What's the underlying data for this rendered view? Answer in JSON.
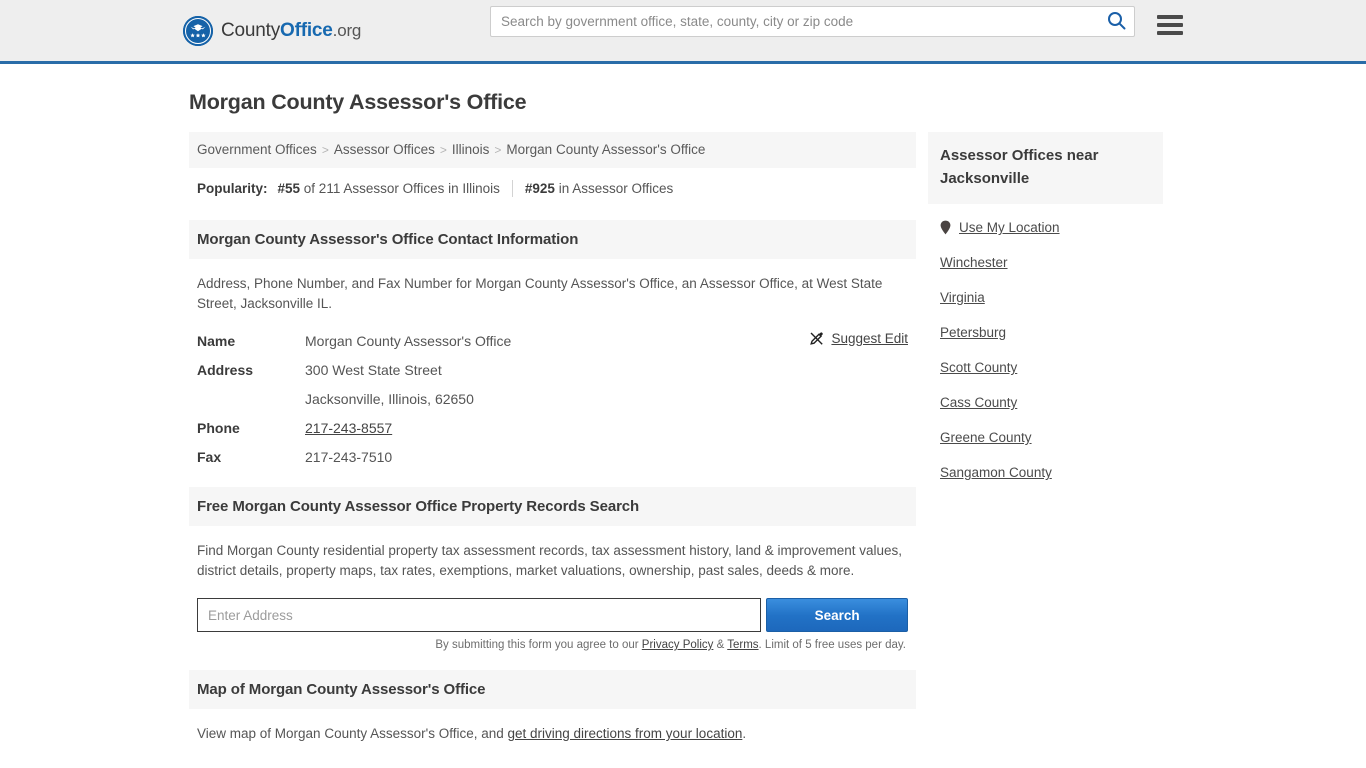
{
  "header": {
    "logo": {
      "icon": "eagle-shield-logo-icon",
      "text_part1": "County",
      "text_part2": "Office",
      "text_part3": ".org"
    },
    "search": {
      "placeholder": "Search by government office, state, county, city or zip code",
      "value": "",
      "button_icon": "search-icon"
    },
    "menu_icon": "hamburger-menu-icon",
    "accent_color": "#2a6ca8",
    "background_color": "#eeeeee"
  },
  "page": {
    "title": "Morgan County Assessor's Office"
  },
  "breadcrumb": {
    "separator": ">",
    "items": [
      {
        "label": "Government Offices",
        "current": false
      },
      {
        "label": "Assessor Offices",
        "current": false
      },
      {
        "label": "Illinois",
        "current": false
      },
      {
        "label": "Morgan County Assessor's Office",
        "current": true
      }
    ]
  },
  "popularity": {
    "label": "Popularity:",
    "state_rank": "#55",
    "state_rank_text": " of 211 Assessor Offices in Illinois",
    "national_rank": "#925",
    "national_rank_text": " in Assessor Offices"
  },
  "contact_section": {
    "heading": "Morgan County Assessor's Office Contact Information",
    "description": "Address, Phone Number, and Fax Number for Morgan County Assessor's Office, an Assessor Office, at West State Street, Jacksonville IL.",
    "suggest_edit": {
      "label": "Suggest Edit",
      "icon": "edit-pencil-icon"
    },
    "rows": [
      {
        "key": "Name",
        "value": "Morgan County Assessor's Office",
        "link": false
      },
      {
        "key": "Address",
        "value": "300 West State Street",
        "link": false
      },
      {
        "key": "",
        "value": "Jacksonville, Illinois, 62650",
        "link": false
      },
      {
        "key": "Phone",
        "value": "217-243-8557",
        "link": true
      },
      {
        "key": "Fax",
        "value": "217-243-7510",
        "link": false
      }
    ]
  },
  "records_section": {
    "heading": "Free Morgan County Assessor Office Property Records Search",
    "description": "Find Morgan County residential property tax assessment records, tax assessment history, land & improvement values, district details, property maps, tax rates, exemptions, market valuations, ownership, past sales, deeds & more.",
    "address_placeholder": "Enter Address",
    "address_value": "",
    "search_button": "Search",
    "note_prefix": "By submitting this form you agree to our ",
    "note_privacy": "Privacy Policy",
    "note_amp": " & ",
    "note_terms": "Terms",
    "note_suffix": ". Limit of 5 free uses per day.",
    "button_color": "#2272c6"
  },
  "map_section": {
    "heading": "Map of Morgan County Assessor's Office",
    "description_prefix": "View map of Morgan County Assessor's Office, and ",
    "description_link": "get driving directions from your location",
    "description_suffix": "."
  },
  "sidebar": {
    "heading": "Assessor Offices near Jacksonville",
    "use_my_location": {
      "label": "Use My Location",
      "icon": "map-pin-icon"
    },
    "items": [
      {
        "label": "Winchester"
      },
      {
        "label": "Virginia"
      },
      {
        "label": "Petersburg"
      },
      {
        "label": "Scott County"
      },
      {
        "label": "Cass County"
      },
      {
        "label": "Greene County"
      },
      {
        "label": "Sangamon County"
      }
    ]
  }
}
